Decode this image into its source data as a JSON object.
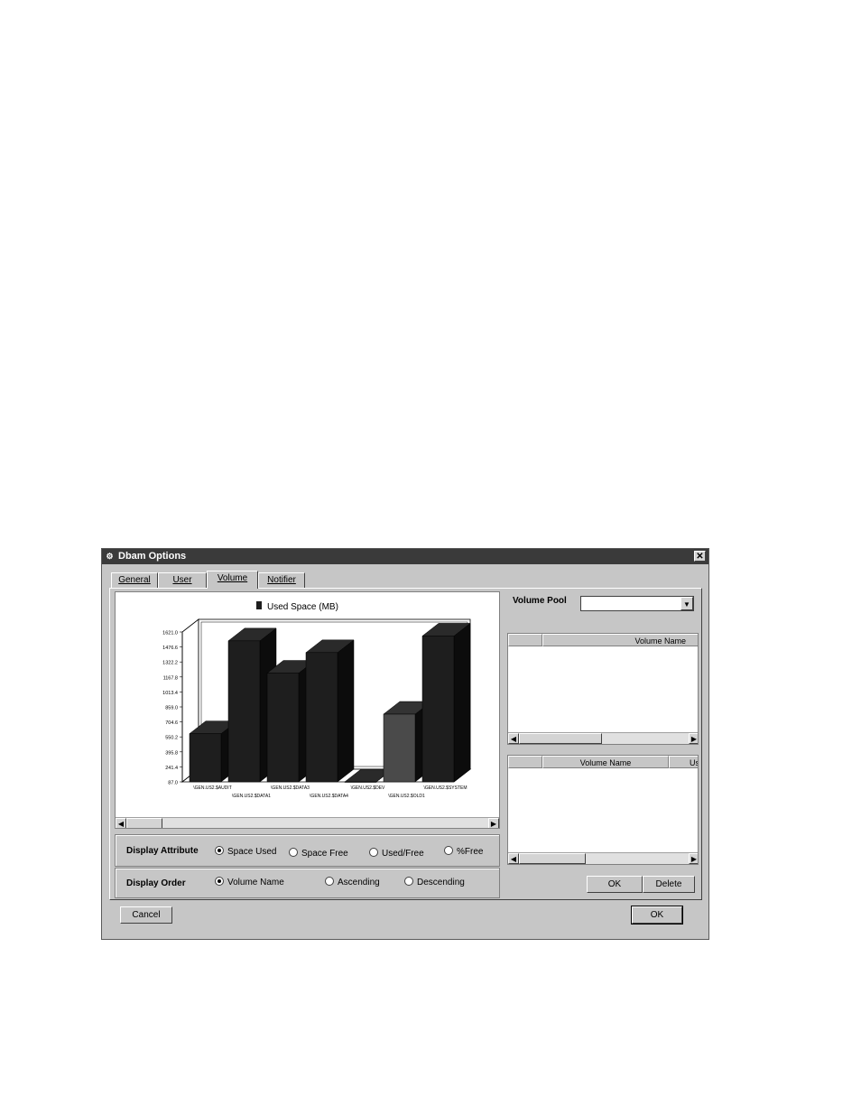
{
  "window": {
    "title": "Dbam Options",
    "close_label": "✕"
  },
  "tabs": [
    {
      "label": "General",
      "active": false
    },
    {
      "label": "User",
      "active": false
    },
    {
      "label": "Volume",
      "active": true
    },
    {
      "label": "Notifier",
      "active": false
    }
  ],
  "chart_data": {
    "type": "bar",
    "legend": "Used Space (MB)",
    "categories": [
      "\\GEN.US2.$AUDIT",
      "\\GEN.US2.$DATA1",
      "\\GEN.US2.$DATA3",
      "\\GEN.US2.$DATA4",
      "\\GEN.US2.$DEV",
      "\\GEN.US2.$OLD1",
      "\\GEN.US2.$SYSTEM"
    ],
    "values": [
      580,
      1530,
      1200,
      1410,
      10,
      780,
      1580
    ],
    "yticks": [
      "1621.0",
      "1476.6",
      "1322.2",
      "1167.8",
      "1013.4",
      "859.0",
      "704.6",
      "550.2",
      "395.8",
      "241.4",
      "87.0"
    ],
    "ylim": [
      87.0,
      1621.0
    ],
    "colors": [
      "#1e1e1e",
      "#1e1e1e",
      "#1e1e1e",
      "#1e1e1e",
      "#1e1e1e",
      "#4a4a4a",
      "#1e1e1e"
    ]
  },
  "display_attribute": {
    "label": "Display Attribute",
    "options": [
      {
        "label": "Space Used",
        "selected": true
      },
      {
        "label": "Space Free",
        "selected": false
      },
      {
        "label": "Used/Free",
        "selected": false
      },
      {
        "label": "%Free",
        "selected": false
      }
    ]
  },
  "display_order": {
    "label": "Display Order",
    "options": [
      {
        "label": "Volume Name",
        "selected": true
      },
      {
        "label": "Ascending",
        "selected": false
      },
      {
        "label": "Descending",
        "selected": false
      }
    ]
  },
  "volume_pool": {
    "label": "Volume Pool",
    "value": ""
  },
  "list1": {
    "header": "Volume Name"
  },
  "list2": {
    "header": "Volume Name",
    "header2": "Us"
  },
  "buttons": {
    "ok_inner": "OK",
    "delete": "Delete",
    "cancel": "Cancel",
    "ok": "OK"
  },
  "colors": {
    "title_bar": "#3a3a3a",
    "face": "#c6c6c6"
  }
}
